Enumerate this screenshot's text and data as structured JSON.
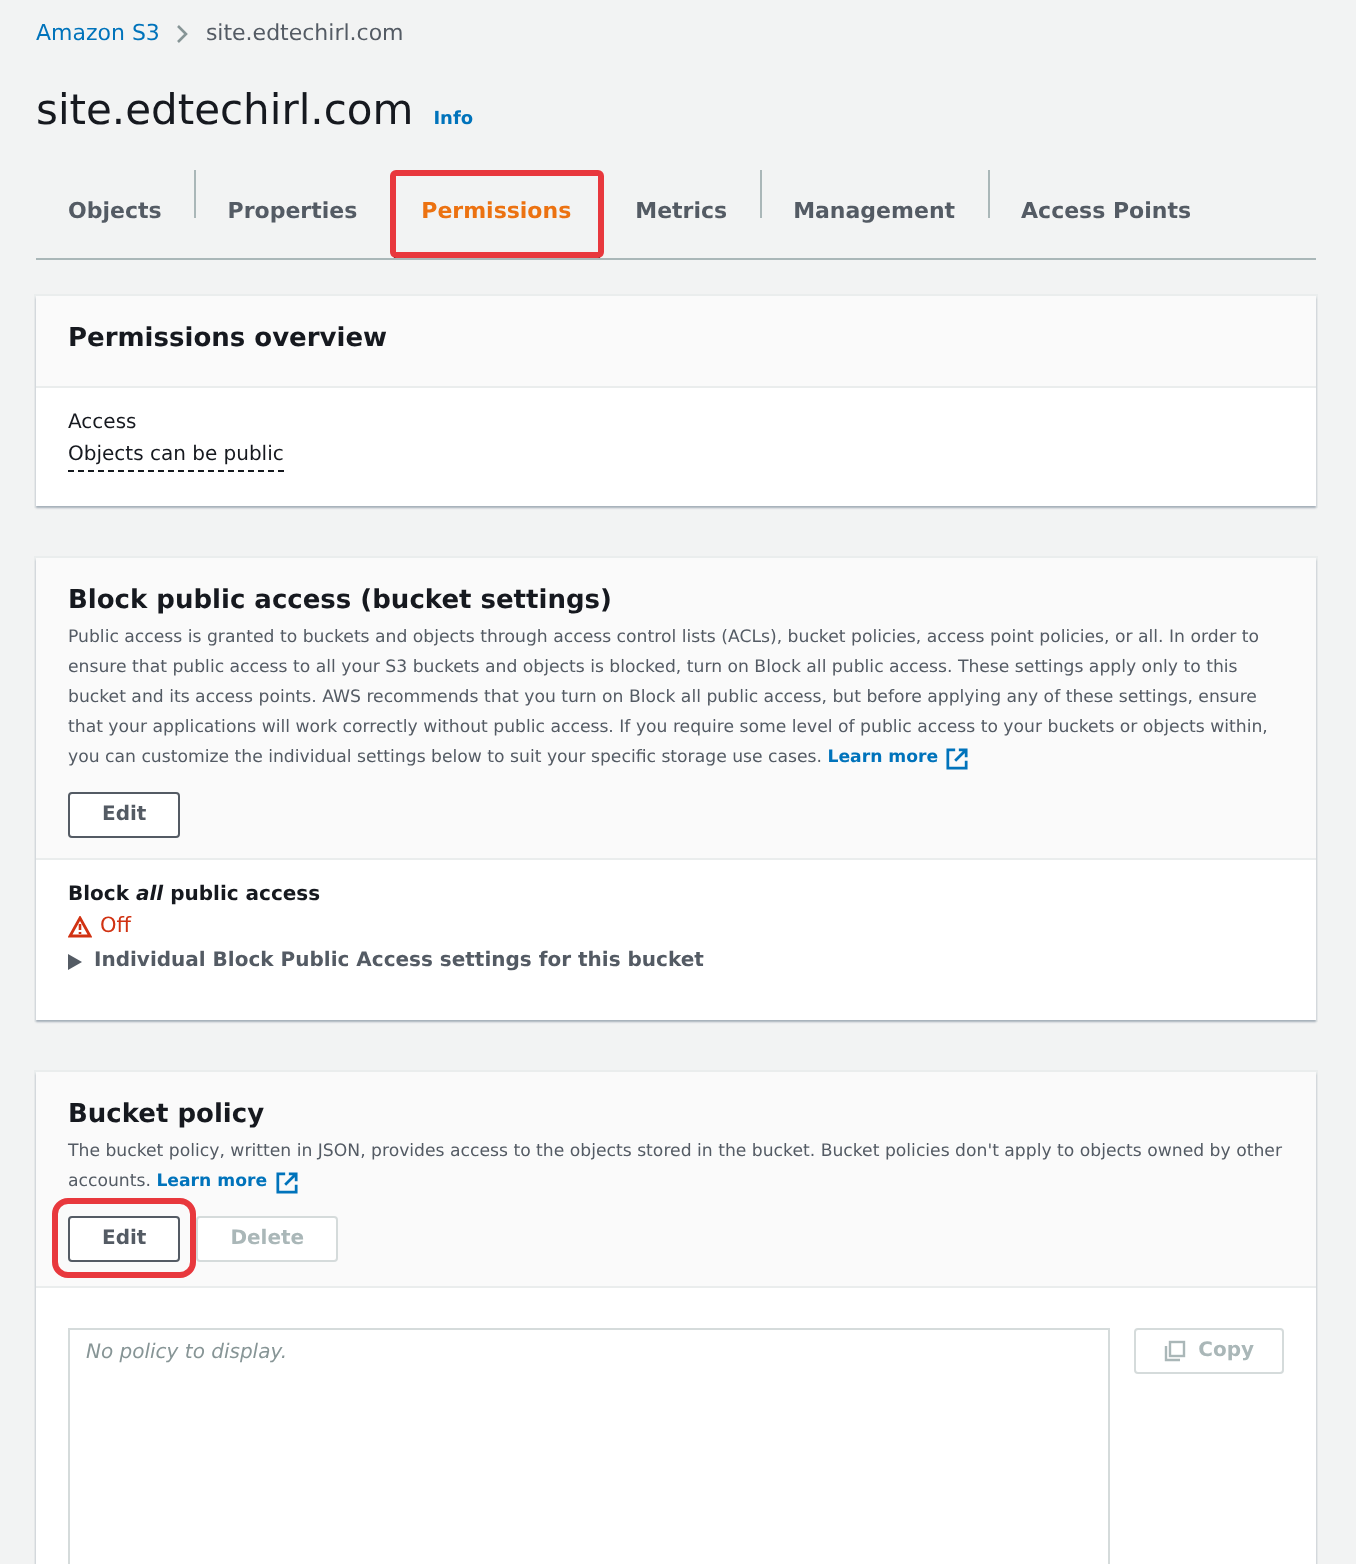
{
  "breadcrumb": [
    {
      "label": "Amazon S3",
      "kind": "link"
    },
    {
      "label": "site.edtechirl.com",
      "kind": "current"
    }
  ],
  "title": "site.edtechirl.com",
  "info": "Info",
  "tabs": [
    {
      "label": "Objects",
      "selected": false,
      "highlighted": false
    },
    {
      "label": "Properties",
      "selected": false,
      "highlighted": false
    },
    {
      "label": "Permissions",
      "selected": true,
      "highlighted": true
    },
    {
      "label": "Metrics",
      "selected": false,
      "highlighted": false
    },
    {
      "label": "Management",
      "selected": false,
      "highlighted": false
    },
    {
      "label": "Access Points",
      "selected": false,
      "highlighted": false
    }
  ],
  "overview": {
    "title": "Permissions overview",
    "label": "Access",
    "value": "Objects can be public"
  },
  "block_public_access": {
    "title": "Block public access (bucket settings)",
    "description": "Public access is granted to buckets and objects through access control lists (ACLs), bucket policies, access point policies, or all. In order to ensure that public access to all your S3 buckets and objects is blocked, turn on Block all public access. These settings apply only to this bucket and its access points. AWS recommends that you turn on Block all public access, but before applying any of these settings, ensure that your applications will work correctly without public access. If you require some level of public access to your buckets or objects within, you can customize the individual settings below to suit your specific storage use cases.",
    "learn_more": "Learn more",
    "buttons": [
      {
        "label": "Edit",
        "disabled": false,
        "highlighted": false
      }
    ],
    "setting_label": "Block *all* public access",
    "status": "Off",
    "warning": true,
    "expander": {
      "label": "Individual Block Public Access settings for this bucket",
      "expanded": false
    }
  },
  "bucket_policy": {
    "title": "Bucket policy",
    "description": "The bucket policy, written in JSON, provides access to the objects stored in the bucket. Bucket policies don't apply to objects owned by other accounts.",
    "learn_more": "Learn more",
    "buttons": [
      {
        "label": "Edit",
        "disabled": false,
        "highlighted": true
      },
      {
        "label": "Delete",
        "disabled": true,
        "highlighted": false
      }
    ],
    "policy": {
      "placeholder": "No policy to display."
    },
    "copy": {
      "label": "Copy",
      "disabled": true
    }
  }
}
